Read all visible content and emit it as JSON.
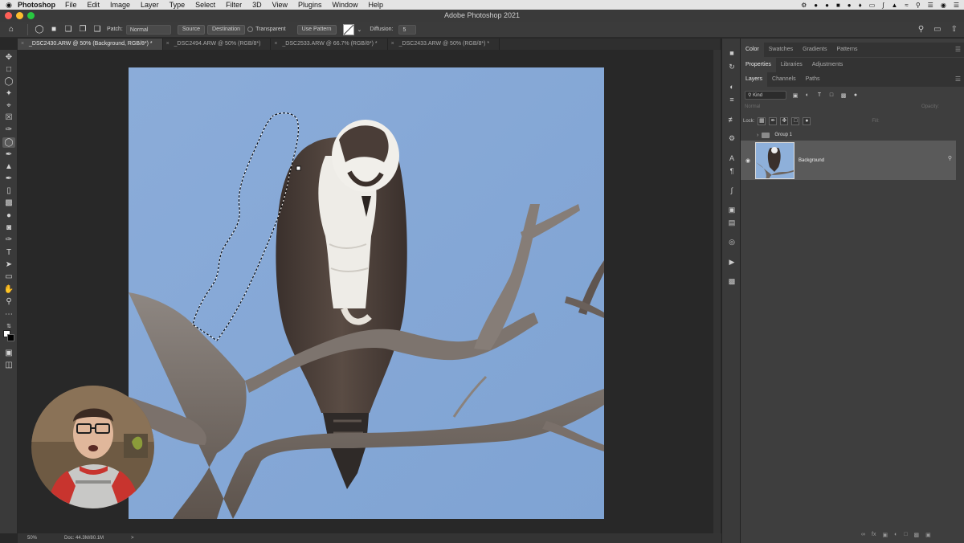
{
  "menubar": {
    "apple_icon": "apple-icon",
    "app": "Photoshop",
    "items": [
      "File",
      "Edit",
      "Image",
      "Layer",
      "Type",
      "Select",
      "Filter",
      "3D",
      "View",
      "Plugins",
      "Window",
      "Help"
    ]
  },
  "window": {
    "title": "Adobe Photoshop 2021"
  },
  "options_bar": {
    "patch_label": "Patch:",
    "patch_value": "Normal",
    "source_label": "Source",
    "destination_label": "Destination",
    "transparent_label": "Transparent",
    "use_pattern_label": "Use Pattern",
    "diffusion_label": "Diffusion:",
    "diffusion_value": "5"
  },
  "tabs": [
    {
      "label": "_DSC2430.ARW @ 50% (Background, RGB/8*) *",
      "active": true
    },
    {
      "label": "_DSC2494.ARW @ 50% (RGB/8*)",
      "active": false
    },
    {
      "label": "_DSC2533.ARW @ 66.7% (RGB/8*) *",
      "active": false
    },
    {
      "label": "_DSC2433.ARW @ 50% (RGB/8*) *",
      "active": false
    }
  ],
  "status": {
    "zoom": "50%",
    "doc": "Doc: 44.3M/80.1M",
    "arrow": ">"
  },
  "panels": {
    "top_tabs": [
      "Color",
      "Swatches",
      "Gradients",
      "Patterns"
    ],
    "mid_tabs": [
      "Properties",
      "Libraries",
      "Adjustments"
    ],
    "layer_tabs": [
      "Layers",
      "Channels",
      "Paths"
    ],
    "kind": "Kind",
    "blend_mode": "Normal",
    "opacity_label": "Opacity:",
    "lock_label": "Lock:",
    "fill_label": "Fill:",
    "group_name": "Group 1",
    "layer_name": "Background"
  },
  "colors": {
    "sky": "#8eb0da",
    "accent_tab": "#474747",
    "panel_bg": "#3e3e3e"
  }
}
